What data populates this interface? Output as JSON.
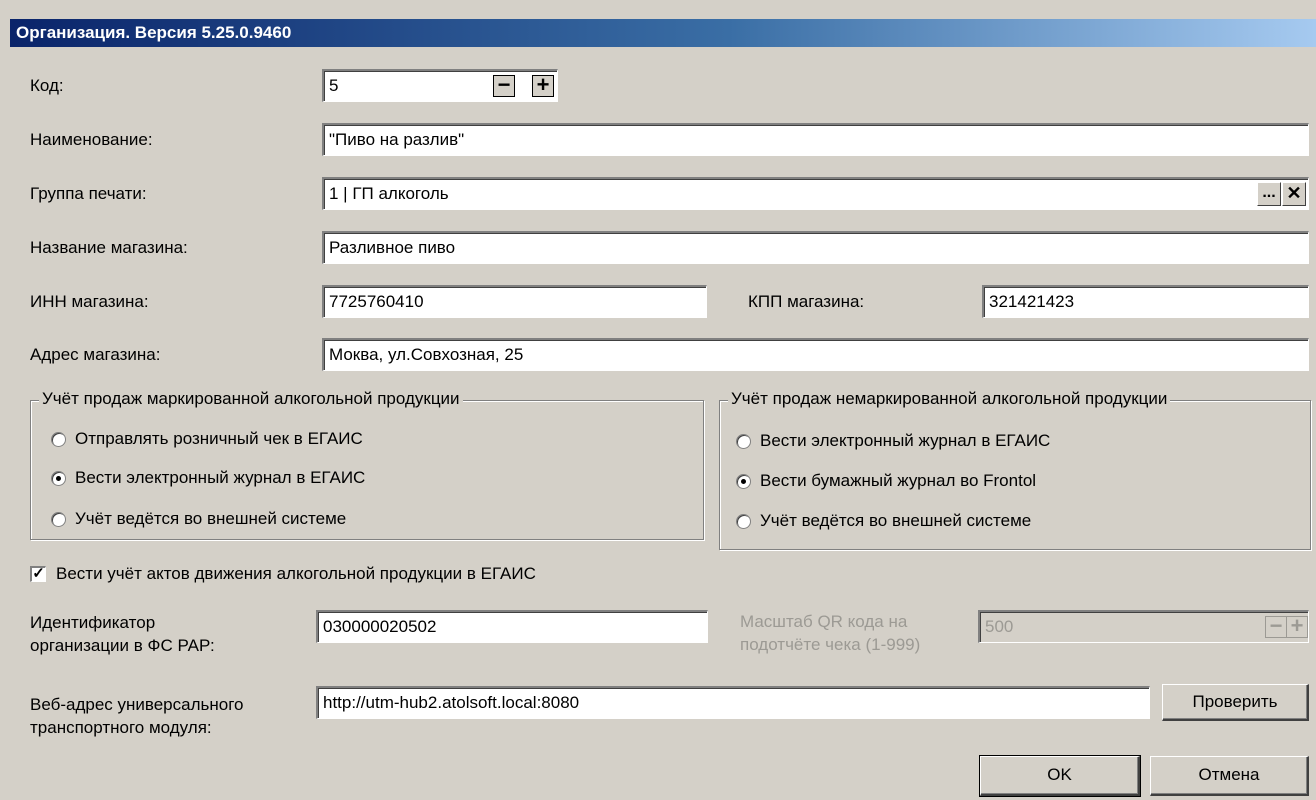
{
  "window": {
    "title": "Организация. Версия 5.25.0.9460"
  },
  "form": {
    "code": {
      "label": "Код:",
      "value": "5",
      "minus": "−",
      "plus": "+"
    },
    "name": {
      "label": "Наименование:",
      "value": "\"Пиво на разлив\""
    },
    "print_group": {
      "label": "Группа печати:",
      "value": "1 | ГП алкоголь",
      "browse": "...",
      "clear": "✕"
    },
    "shop_name": {
      "label": "Название магазина:",
      "value": "Разливное пиво"
    },
    "inn": {
      "label": "ИНН магазина:",
      "value": "7725760410"
    },
    "kpp": {
      "label": "КПП магазина:",
      "value": "321421423"
    },
    "address": {
      "label": "Адрес магазина:",
      "value": "Моква, ул.Совхозная, 25"
    }
  },
  "marked_group": {
    "title": "Учёт продаж маркированной алкогольной продукции",
    "options": [
      "Отправлять розничный чек в ЕГАИС",
      "Вести электронный журнал в ЕГАИС",
      "Учёт ведётся во внешней системе"
    ],
    "selected_index": 1
  },
  "unmarked_group": {
    "title": "Учёт продаж немаркированной алкогольной продукции",
    "options": [
      "Вести электронный журнал в ЕГАИС",
      "Вести бумажный журнал во Frontol",
      "Учёт ведётся во внешней системе"
    ],
    "selected_index": 1
  },
  "acts_checkbox": {
    "label": "Вести учёт актов движения алкогольной продукции в ЕГАИС",
    "checked": true,
    "mark": "✓"
  },
  "fsrar": {
    "label_line1": "Идентификатор",
    "label_line2": "организации в ФС РАР:",
    "value": "030000020502"
  },
  "qr_scale": {
    "label_line1": "Масштаб QR кода на",
    "label_line2": "подотчёте чека (1-999)",
    "value": "500",
    "minus": "−",
    "plus": "+",
    "enabled": false
  },
  "utm": {
    "label_line1": "Веб-адрес универсального",
    "label_line2": "транспортного модуля:",
    "value": "http://utm-hub2.atolsoft.local:8080",
    "check_button": "Проверить"
  },
  "buttons": {
    "ok": "OK",
    "cancel": "Отмена"
  }
}
